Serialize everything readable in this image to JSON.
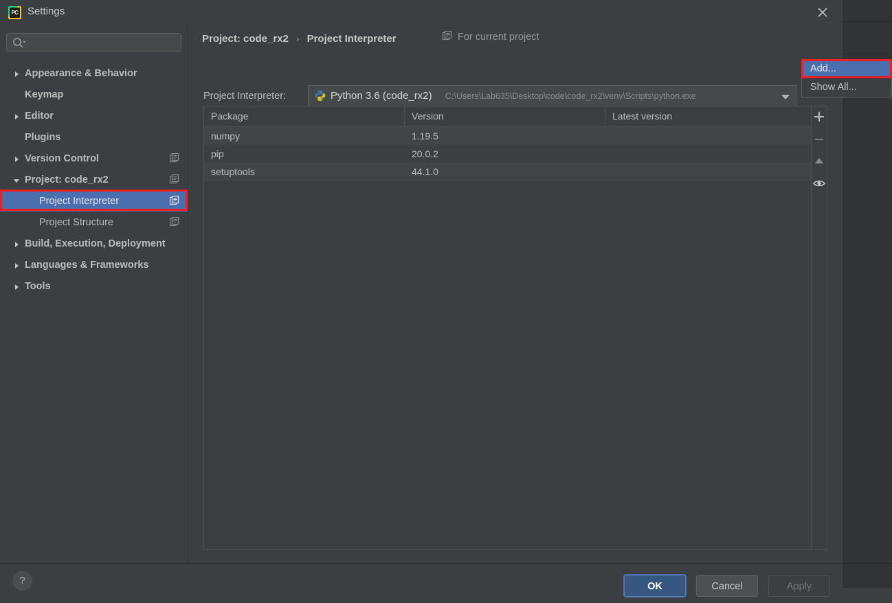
{
  "window": {
    "title": "Settings",
    "app_icon": "pycharm-icon",
    "close_icon": "close-icon"
  },
  "sidebar": {
    "search": {
      "placeholder": "",
      "value": "",
      "icon": "search-icon"
    },
    "items": [
      {
        "label": "Appearance & Behavior",
        "arrow": "collapsed",
        "indent": 0,
        "bold": true,
        "module_icon": false,
        "selected": false
      },
      {
        "label": "Keymap",
        "arrow": "none",
        "indent": 0,
        "bold": true,
        "module_icon": false,
        "selected": false
      },
      {
        "label": "Editor",
        "arrow": "collapsed",
        "indent": 0,
        "bold": true,
        "module_icon": false,
        "selected": false
      },
      {
        "label": "Plugins",
        "arrow": "none",
        "indent": 0,
        "bold": true,
        "module_icon": false,
        "selected": false
      },
      {
        "label": "Version Control",
        "arrow": "collapsed",
        "indent": 0,
        "bold": true,
        "module_icon": true,
        "selected": false
      },
      {
        "label": "Project: code_rx2",
        "arrow": "expanded",
        "indent": 0,
        "bold": true,
        "module_icon": true,
        "selected": false
      },
      {
        "label": "Project Interpreter",
        "arrow": "none",
        "indent": 1,
        "bold": false,
        "module_icon": true,
        "selected": true
      },
      {
        "label": "Project Structure",
        "arrow": "none",
        "indent": 1,
        "bold": false,
        "module_icon": true,
        "selected": false
      },
      {
        "label": "Build, Execution, Deployment",
        "arrow": "collapsed",
        "indent": 0,
        "bold": true,
        "module_icon": false,
        "selected": false
      },
      {
        "label": "Languages & Frameworks",
        "arrow": "collapsed",
        "indent": 0,
        "bold": true,
        "module_icon": false,
        "selected": false
      },
      {
        "label": "Tools",
        "arrow": "collapsed",
        "indent": 0,
        "bold": true,
        "module_icon": false,
        "selected": false
      }
    ]
  },
  "header": {
    "breadcrumb_parent": "Project: code_rx2",
    "breadcrumb_sep": "›",
    "breadcrumb_current": "Project Interpreter",
    "scope_icon": "module-icon",
    "scope_label": "For current project"
  },
  "interpreter": {
    "label": "Project Interpreter:",
    "icon": "python-venv-icon",
    "name": "Python 3.6 (code_rx2)",
    "path": "C:\\Users\\Lab635\\Desktop\\code\\code_rx2\\venv\\Scripts\\python.exe",
    "caret_icon": "chevron-down-icon"
  },
  "popup_menu": {
    "items": [
      {
        "label": "Add...",
        "active": true
      },
      {
        "label": "Show All...",
        "active": false
      }
    ]
  },
  "packages": {
    "columns": [
      "Package",
      "Version",
      "Latest version"
    ],
    "rows": [
      {
        "package": "numpy",
        "version": "1.19.5",
        "latest": ""
      },
      {
        "package": "pip",
        "version": "20.0.2",
        "latest": ""
      },
      {
        "package": "setuptools",
        "version": "44.1.0",
        "latest": ""
      }
    ],
    "tools": [
      {
        "name": "add-package-icon",
        "glyph": "plus"
      },
      {
        "name": "remove-package-icon",
        "glyph": "minus"
      },
      {
        "name": "upgrade-package-icon",
        "glyph": "triangle-up"
      },
      {
        "name": "show-early-releases-icon",
        "glyph": "eye"
      }
    ]
  },
  "footer": {
    "help_label": "?",
    "ok_label": "OK",
    "cancel_label": "Cancel",
    "apply_label": "Apply"
  },
  "colors": {
    "dialog_bg": "#3c3f41",
    "selection_blue": "#4b6eaf",
    "ok_blue": "#365880",
    "annotation_red": "#f01f1f",
    "text": "#bbbbbb"
  }
}
